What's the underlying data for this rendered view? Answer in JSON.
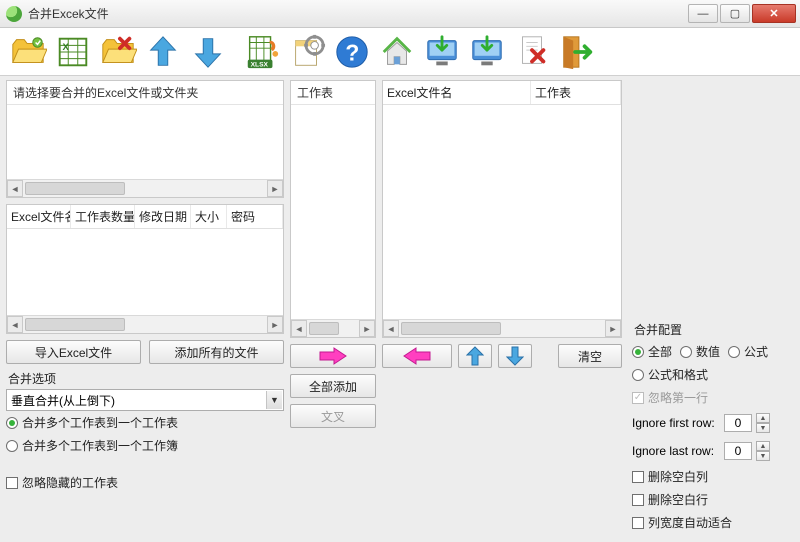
{
  "window": {
    "title": "合并Excek文件"
  },
  "panels": {
    "source": {
      "header": "请选择要合并的Excel文件或文件夹"
    },
    "worksheet": {
      "header": "工作表"
    },
    "grid_cols": [
      "Excel文件名",
      "工作表数量",
      "修改日期",
      "大小",
      "密码"
    ],
    "result_cols": [
      "Excel文件名",
      "工作表"
    ]
  },
  "buttons": {
    "import": "导入Excel文件",
    "add_all_files": "添加所有的文件",
    "add_all": "全部添加",
    "cross": "文叉",
    "clear": "清空"
  },
  "merge_section": {
    "label": "合并选项",
    "combo": "垂直合并(从上倒下)",
    "radio1": "合并多个工作表到一个工作表",
    "radio2": "合并多个工作表到一个工作簿",
    "chk_hidden": "忽略隐藏的工作表"
  },
  "config": {
    "label": "合并配置",
    "r_all": "全部",
    "r_value": "数值",
    "r_formula": "公式",
    "r_fmt": "公式和格式",
    "chk_skip_first": "忽略第一行",
    "ignore_first": "Ignore first row:",
    "ignore_last": "Ignore last row:",
    "val_first": "0",
    "val_last": "0",
    "chk_del_col": "删除空白列",
    "chk_del_row": "删除空白行",
    "chk_autofit": "列宽度自动适合"
  }
}
